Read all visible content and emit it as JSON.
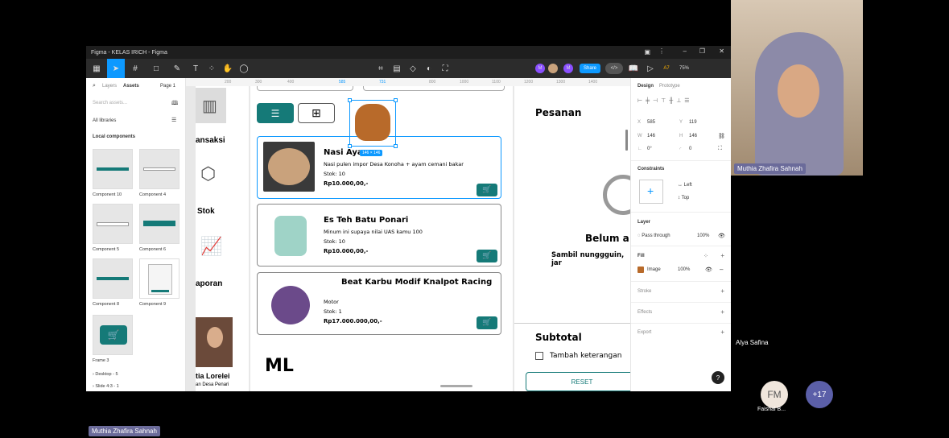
{
  "window": {
    "title": "Figma - KELAS IRICH - Figma"
  },
  "toolbar": {
    "share": "Share",
    "zoom": "75%",
    "avatars": [
      "M",
      "M"
    ],
    "badge": "A7"
  },
  "left_panel": {
    "tabs": [
      "Layers",
      "Assets"
    ],
    "page": "Page 1",
    "search_placeholder": "Search assets...",
    "libraries": "All libraries",
    "section": "Local components",
    "components": [
      "Component 10",
      "Component 4",
      "Component 5",
      "Component 6",
      "Component 8",
      "Component 9",
      "Frame 3"
    ],
    "pages": [
      "Desktop - 5",
      "Slide 4:3 - 1"
    ]
  },
  "ruler": [
    "200",
    "300",
    "400",
    "585",
    "731",
    "800",
    "1000",
    "1100",
    "1200",
    "1300",
    "1400"
  ],
  "canvas": {
    "sidebar": {
      "transaksi": "ansaksi",
      "stok": "Stok",
      "laporan": "aporan",
      "user_name": "tia Lorelei",
      "user_sub": "an Desa Penari"
    },
    "selection_size": "146 × 146",
    "products": [
      {
        "name": "Nasi Ayam",
        "desc": "Nasi pulen impor Desa Konoha + ayam cemani bakar",
        "stok": "Stok: 10",
        "price": "Rp10.000,00,-"
      },
      {
        "name": "Es Teh Batu Ponari",
        "desc": "Minum ini supaya nilai UAS kamu 100",
        "stok": "Stok: 10",
        "price": "Rp10.000,00,-"
      },
      {
        "name": "Beat Karbu Modif Knalpot Racing",
        "desc": "Motor",
        "stok": "Stok: 1",
        "price": "Rp17.000.000,00,-"
      }
    ],
    "ml": "ML",
    "pesanan": "Pesanan",
    "belum": "Belum a",
    "sambil": "Sambil nunggguin, jar",
    "subtotal": "Subtotal",
    "tambah": "Tambah keterangan",
    "reset": "RESET"
  },
  "right_panel": {
    "tabs": [
      "Design",
      "Prototype"
    ],
    "x": "585",
    "y": "119",
    "w": "146",
    "h": "146",
    "rot": "0°",
    "radius": "0",
    "constraints": "Constraints",
    "left": "Left",
    "top": "Top",
    "layer": "Layer",
    "blend": "Pass through",
    "opacity": "100%",
    "fill": "Fill",
    "fill_type": "Image",
    "fill_opacity": "100%",
    "stroke": "Stroke",
    "effects": "Effects",
    "export": "Export"
  },
  "meeting": {
    "presenter": "Muthia Zhafira Sahnah",
    "participant2": "Alya Safina",
    "fm_initials": "FM",
    "fm_name": "Faishal B...",
    "more": "+17",
    "bottom_name": "Muthia Zhafira Sahnah"
  }
}
